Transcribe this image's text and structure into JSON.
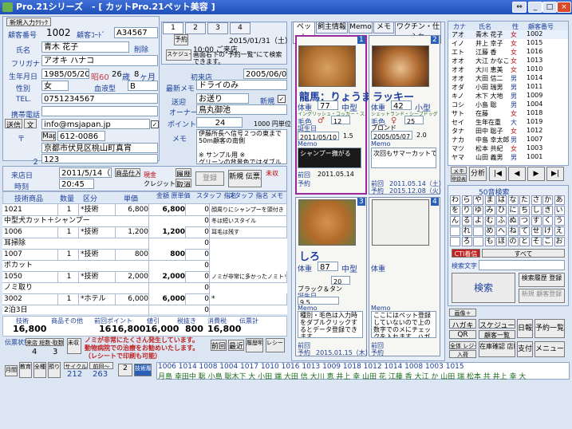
{
  "window": {
    "title": "Pro.21シリーズ　- [ カットPro.21ペット美容 ]",
    "close": "×",
    "min": "_",
    "restore": "□",
    "expand": "⇔"
  },
  "customer": {
    "new_label": "新規入力ｸﾘｯｸ",
    "id_label": "顧客番号",
    "id": "1002",
    "code_label": "顧客ｺｰﾄﾞ",
    "code": "A34567",
    "name_label": "氏名",
    "name": "青木 花子",
    "delete_label": "削除",
    "kana_label": "フリガナ",
    "kana": "アオキ ハナコ",
    "birth_label": "生年月日",
    "birth": "1985/05/20",
    "era": "昭60",
    "age": "26",
    "age_unit": "歳",
    "months": "8",
    "months_unit": "ヶ月",
    "gender_label": "性別",
    "gender": "女",
    "blood_label": "血液型",
    "blood": "B",
    "tel_label": "TEL.",
    "tel": "0751234567",
    "mobile_label": "携帯電話",
    "mobile": "",
    "send_label": "送信",
    "text_label": "文",
    "email": "info@msjapan.jp",
    "zip_label": "〒",
    "zip_btn": "Map",
    "zip": "612-0086",
    "addr_label": "住所一１",
    "addr1": "京都市伏見区桃山町真宵",
    "addr2_label": "２",
    "addr2": "123"
  },
  "reserve": {
    "tab1": "1",
    "tab2": "2",
    "tab3": "3",
    "tab4": "4",
    "btn_reserve": "予約",
    "btn_schedule": "スケジュール",
    "date": "2015/01/31（土）",
    "time_text": "10:00 ご来店",
    "note": "画面右下の\"予約一覧\"にて検索できます。"
  },
  "visit": {
    "first_label": "初来店",
    "first": "2005/06/05",
    "memo_label": "最新メモ",
    "memo": "ドライのみ",
    "delivery_label": "送迎",
    "delivery": "お送り",
    "new_label": "新規",
    "owner_label": "オーナー",
    "owner": "鳥丸御池",
    "point_label": "ポイント",
    "point": "24",
    "point_rate": "1000 円単位",
    "memo2_label": "メモ",
    "memo2": "伊藤所長へ信号２つの東まで50m顧客の南側\n\n※ サンプル用 ※\nグリーンの背景色ではダブル"
  },
  "sales": {
    "date_label": "来店日",
    "date": "2011/5/14（土）",
    "time_label": "時刻",
    "time": "20:45",
    "goods_label": "商品仕入",
    "cash": "現金",
    "credit": "クレジット",
    "history_btn": "履歴",
    "cancel_btn": "取消",
    "register_btn": "登録",
    "new_btn": "新規 伝票入力",
    "unpaid_label": "未収",
    "headers": [
      "技術商品",
      "数量",
      "区分",
      "単価",
      "金額 原単価",
      "原単価",
      "スタッフ 指名",
      "スタッフ 指名 メモ"
    ],
    "rows": [
      {
        "code": "1021",
        "qty": "1",
        "kind": "*技術",
        "price": "6,800",
        "amount": "6,800",
        "cost": "0",
        "memo": "顔周りにシャンプーを頭付き"
      },
      {
        "code": "",
        "name": "中型犬カット＋シャンプー",
        "qty": "",
        "kind": "",
        "price": "",
        "amount": "",
        "cost": "0",
        "memo": "冬は短いスタイル"
      },
      {
        "code": "1006",
        "qty": "1",
        "kind": "*技術",
        "price": "1,200",
        "amount": "1,200",
        "cost": "0",
        "memo": "耳毛は残す"
      },
      {
        "code": "",
        "name": "耳掃除",
        "qty": "",
        "kind": "",
        "price": "",
        "amount": "",
        "cost": "0",
        "memo": ""
      },
      {
        "code": "1007",
        "qty": "1",
        "kind": "*技術",
        "price": "800",
        "amount": "800",
        "cost": "0",
        "memo": ""
      },
      {
        "code": "",
        "name": "ボカット",
        "qty": "",
        "kind": "",
        "price": "",
        "amount": "",
        "cost": "0",
        "memo": ""
      },
      {
        "code": "1050",
        "qty": "1",
        "kind": "*技術",
        "price": "2,000",
        "amount": "2,000",
        "cost": "0",
        "memo": "ノミが非常に多かったノミトリシャンプー推め"
      },
      {
        "code": "",
        "name": "ノミ取り",
        "qty": "",
        "kind": "",
        "price": "",
        "amount": "",
        "cost": "0",
        "memo": ""
      },
      {
        "code": "3002",
        "qty": "1",
        "kind": "*ホテル",
        "price": "6,000",
        "amount": "6,000",
        "cost": "0",
        "memo": "*"
      },
      {
        "code": "",
        "name": "2泊3日",
        "qty": "",
        "kind": "",
        "price": "",
        "amount": "",
        "cost": "0",
        "memo": ""
      }
    ],
    "totals_labels": [
      "技術",
      "商品その他",
      "前回ポイント",
      "値引",
      "税抜き",
      "消費税",
      "伝票計"
    ],
    "totals": [
      "16,800",
      "",
      "16",
      "16,800",
      "16,000",
      "800",
      "16,800"
    ],
    "prev_btn": "前回",
    "recent_btn": "最近",
    "history2_btn": "履歴明細",
    "receipt_btn": "レシートおかり",
    "status_label": "伝票状態",
    "visit_count_label": "来店 総数-取数",
    "visit_count1": "4",
    "visit_count2": "3",
    "unpaid2": "未収 金",
    "alert": "ノミが非常にたくさん発生しています。\n動物病院での治療をお勧めいたします。（レシートで印刷も可能）",
    "bottom_btns": [
      "月間",
      "教育会員",
      "全種目管理",
      "預り伝票",
      "サイクル",
      "前回〜"
    ],
    "counts": [
      "212",
      "263"
    ],
    "count_unit": "種別",
    "next_btn": "2",
    "first_btn": "技術履歴"
  },
  "pets": {
    "tabs": [
      "ペット",
      "飼主情報",
      "Memo",
      "メモ",
      "ワクチン・仕入れ"
    ],
    "cards": [
      {
        "index": "1",
        "name": "龍馬：りょうま",
        "weight_label": "体重",
        "weight": "77",
        "size": "中型",
        "breed": "イングリッシュ・コッカー・スパニエル",
        "sex_label": "毛色",
        "sex": "♂",
        "age": "12",
        "birth_label": "誕生日",
        "birth": "2011/05/10",
        "rank": "1.5",
        "memo_label": "Memo",
        "memo_text": "シャンプー撫がる",
        "last_label": "前回",
        "last": "2011.05.14",
        "next_label": "予約"
      },
      {
        "index": "2",
        "name": "ラッキー",
        "weight_label": "体重",
        "weight": "42",
        "size": "小型",
        "breed": "シェットランド・シープドッグ",
        "sex_label": "毛色",
        "sex": "♀",
        "age": "25",
        "birth_label": "誕生日",
        "birth": "2005/05/07",
        "rank": "2.0",
        "color": "ブロンド",
        "memo_label": "Memo",
        "memo_text": "次回もサマーカットで",
        "last_label": "前回",
        "last": "2011.05.14（土）",
        "next_label": "予約",
        "next": "2015.12.08（火）"
      },
      {
        "index": "3",
        "name": "しろ",
        "weight_label": "体重",
        "weight": "87",
        "size": "中型",
        "breed": "",
        "color": "ブラック＆タン",
        "age": "20",
        "birth_label": "誕生日",
        "birth": "9.5",
        "memo_label": "Memo",
        "memo_text": "種別・毛色は入力時をダブルクリックするとデータ登録できます",
        "last_label": "前回",
        "last": "",
        "next_label": "予約",
        "next": "2015.01.15（木）"
      },
      {
        "index": "4",
        "name": "",
        "weight_label": "体重",
        "memo_label": "Memo",
        "memo_text": "ここにはペット登録していないので上の数字でのメにチェックを入れます。ハガキ発出とペットを表示します",
        "last_label": "前回",
        "next_label": "予約"
      }
    ]
  },
  "list": {
    "header": [
      "カナ",
      "氏名",
      "性",
      "顧客番号"
    ],
    "rows": [
      [
        "アオ",
        "青木 花子",
        "女",
        "1002"
      ],
      [
        "イノ",
        "井上 幸子",
        "女",
        "1015"
      ],
      [
        "エト",
        "江藤 香",
        "女",
        "1016"
      ],
      [
        "オオ",
        "大江 かなこ",
        "女",
        "1013"
      ],
      [
        "オオ",
        "大川 恵美",
        "女",
        "1010"
      ],
      [
        "オオ",
        "大田 信二",
        "男",
        "1014"
      ],
      [
        "オダ",
        "小田 瑞男",
        "男",
        "1011"
      ],
      [
        "キノ",
        "木下 大地",
        "男",
        "1009"
      ],
      [
        "コシ",
        "小島 聡",
        "男",
        "1004"
      ],
      [
        "サト",
        "在藤 ",
        "女",
        "1018"
      ],
      [
        "セイ",
        "生年在重",
        "大",
        "1019"
      ],
      [
        "タナ",
        "田中 聡子",
        "女",
        "1012"
      ],
      [
        "ナカ",
        "中島 幸太郎",
        "男",
        "1007"
      ],
      [
        "マツ",
        "松本 共紀",
        "女",
        "1003"
      ],
      [
        "ヤマ",
        "山田 義男",
        "男",
        "1001"
      ]
    ],
    "memo_btn": "メモ",
    "register_btn": "登録表示",
    "analysis_btn": "分析",
    "nav": [
      "|◀",
      "◀",
      "▶",
      "▶|"
    ],
    "search50": "50音検索",
    "kana_rows": [
      "わらやまはなたさかあ",
      "をりゆみひにちしきい",
      "んるよむふぬつすくう",
      "　れ　めへねてせけえ",
      "　ろ　もほのとそこお"
    ],
    "cti_label": "CTI着信",
    "all_label": "すべて",
    "search_label": "検索文字",
    "search_btn": "検索",
    "search_hist": "検索履歴 登録",
    "new_btn": "新規 顧客登録"
  },
  "tools": {
    "image_btn": "画像＋",
    "hagaki": "ハガキ",
    "qr": "QR",
    "schedule_btn": "スケジュール",
    "newsletter": "顧客一覧",
    "report": "日報",
    "reserve_list": "予約一覧",
    "inventory": "在庫確認 店販履歴",
    "settle": "支付",
    "menu": "メニュー",
    "receipt": "預収書",
    "arrival": "入荷",
    "total": "全体 レジート"
  },
  "strip": {
    "ids": [
      "1006",
      "1014",
      "1008",
      "1004",
      "1017",
      "1010",
      "1016",
      "1013",
      "1009",
      "1018",
      "1012",
      "1014",
      "1008",
      "1003",
      "1015"
    ],
    "names": [
      "月島 幸田中",
      "聡 小島",
      "聡木下",
      "大 小田",
      "端 大田",
      "信 大川",
      "恵 井上",
      "幸 山田",
      "花 江藤",
      "香 大江",
      "か 山田",
      "瑞 松本",
      "共 井上",
      "幸",
      "大"
    ]
  }
}
